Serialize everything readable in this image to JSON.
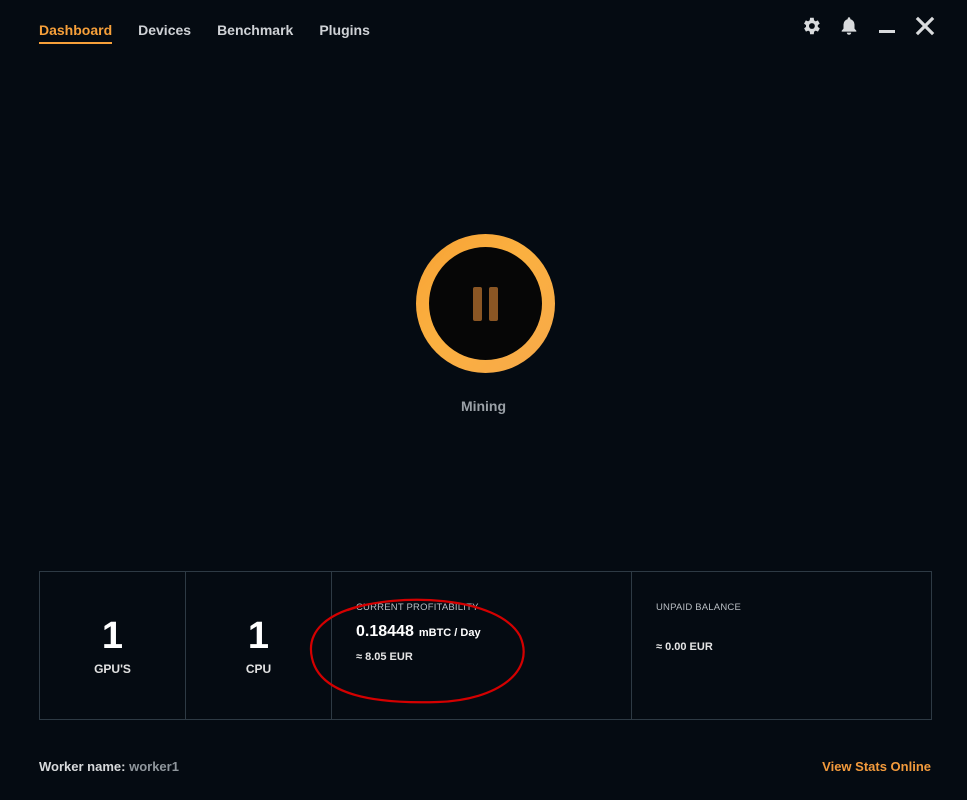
{
  "nav": {
    "tabs": [
      {
        "label": "Dashboard",
        "active": true
      },
      {
        "label": "Devices",
        "active": false
      },
      {
        "label": "Benchmark",
        "active": false
      },
      {
        "label": "Plugins",
        "active": false
      }
    ]
  },
  "window_controls": {
    "icons": [
      "gear-icon",
      "bell-icon",
      "minimize-icon",
      "close-icon"
    ]
  },
  "mining": {
    "status_label": "Mining",
    "button_icon": "pause-icon"
  },
  "stats": {
    "gpus": {
      "value": "1",
      "label": "GPU'S"
    },
    "cpus": {
      "value": "1",
      "label": "CPU"
    },
    "profitability": {
      "label": "CURRENT PROFITABILITY",
      "value": "0.18448",
      "unit": "mBTC / Day",
      "fiat": "≈ 8.05 EUR"
    },
    "balance": {
      "label": "UNPAID BALANCE",
      "fiat": "≈ 0.00 EUR"
    }
  },
  "footer": {
    "worker_label": "Worker name:",
    "worker_value": "worker1",
    "view_stats_label": "View Stats Online"
  },
  "colors": {
    "accent": "#f7a03a",
    "background": "#050b12",
    "annotation": "#d40000"
  }
}
